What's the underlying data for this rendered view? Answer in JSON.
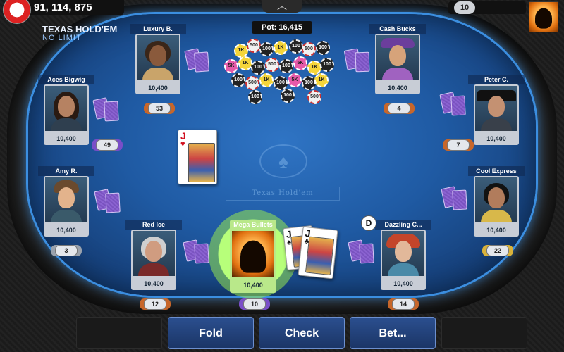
{
  "header": {
    "balance": "91, 114, 875",
    "game_title": "TEXAS HOLD'EM",
    "game_subtitle": "NO LIMIT",
    "menu_label": "︿",
    "player_level": "10"
  },
  "table": {
    "pot_label": "Pot: 16,415",
    "felt_text": "Texas Hold'em",
    "dealer_button": "D"
  },
  "pot_chips": [
    "1K",
    "500",
    "100",
    "1K",
    "100",
    "500",
    "100",
    "5K",
    "1K",
    "100",
    "500",
    "100",
    "5K",
    "1K",
    "100",
    "100",
    "500",
    "1K",
    "100",
    "5K",
    "100",
    "1K",
    "100",
    "100",
    "500"
  ],
  "seats": [
    {
      "name": "Luxury B.",
      "stack": "10,400",
      "level": "53"
    },
    {
      "name": "Cash Bucks",
      "stack": "10,400",
      "level": "4"
    },
    {
      "name": "Aces Bigwig",
      "stack": "10,400",
      "level": "49"
    },
    {
      "name": "Peter C.",
      "stack": "10,400",
      "level": "7"
    },
    {
      "name": "Amy R.",
      "stack": "10,400",
      "level": "3"
    },
    {
      "name": "Cool Express",
      "stack": "10,400",
      "level": "22"
    },
    {
      "name": "Red Ice",
      "stack": "10,400",
      "level": "12"
    },
    {
      "name": "Dazzling C...",
      "stack": "10,400",
      "level": "14"
    }
  ],
  "hero": {
    "name": "Mega Bullets",
    "stack": "10,400",
    "level": "10"
  },
  "community_card": {
    "rank": "J",
    "suit": "♥"
  },
  "hero_cards": [
    {
      "rank": "J",
      "suit": "♠"
    },
    {
      "rank": "J",
      "suit": "♣"
    }
  ],
  "actions": {
    "fold": "Fold",
    "check": "Check",
    "bet": "Bet..."
  }
}
